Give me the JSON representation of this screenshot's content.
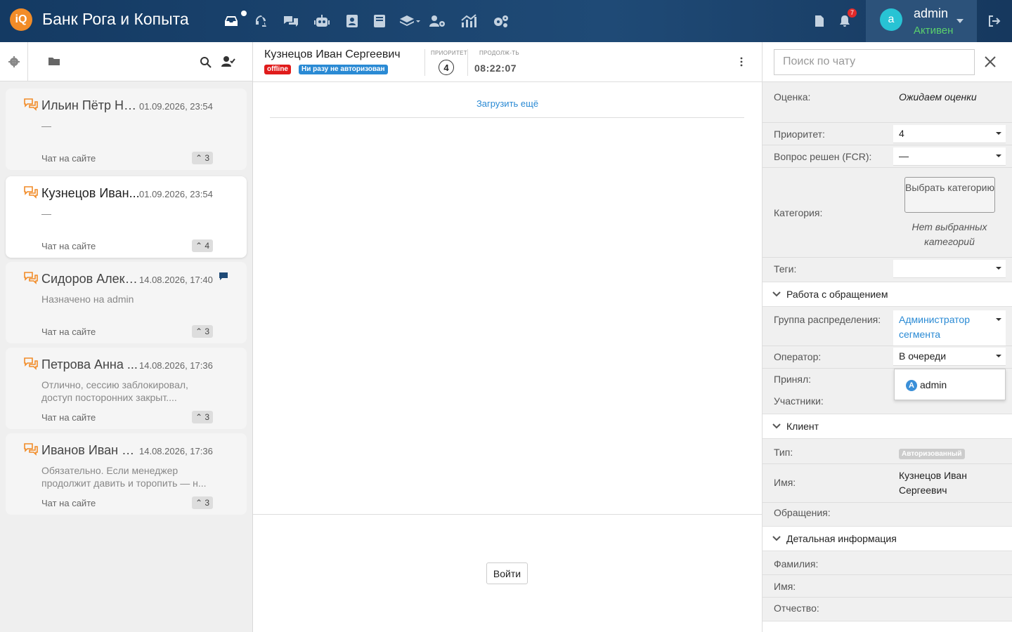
{
  "app": {
    "brand": "Банк Рога и Копыта",
    "logo_text": "iQ"
  },
  "topbar": {
    "notifications_count": "7",
    "user": {
      "initial": "a",
      "name": "admin",
      "status": "Активен"
    }
  },
  "chat_list": [
    {
      "name": "Ильин Пётр Ни...",
      "date": "01.09.2026, 23:54",
      "preview": "—",
      "source": "Чат на сайте",
      "priority": "3"
    },
    {
      "name": "Кузнецов Иван...",
      "date": "01.09.2026, 23:54",
      "preview": "—",
      "source": "Чат на сайте",
      "priority": "4"
    },
    {
      "name": "Сидоров Алекс...",
      "date": "14.08.2026, 17:40",
      "preview": "Назначено на admin",
      "source": "Чат на сайте",
      "priority": "3"
    },
    {
      "name": "Петрова Анна ...",
      "date": "14.08.2026, 17:36",
      "preview": "Отлично, сессию заблокировал, доступ посторонних закрыт....",
      "source": "Чат на сайте",
      "priority": "3"
    },
    {
      "name": "Иванов Иван И...",
      "date": "14.08.2026, 17:36",
      "preview": "Обязательно. Если менеджер продолжит давить и торопить — н...",
      "source": "Чат на сайте",
      "priority": "3"
    }
  ],
  "chat": {
    "name": "Кузнецов Иван Сергеевич",
    "tag_offline": "offline",
    "tag_auth": "Ни разу не авторизован",
    "priority_label": "ПРИОРИТЕТ",
    "priority": "4",
    "duration_label": "ПРОДОЛЖ-ТЬ",
    "duration": "08:22:07",
    "load_more": "Загрузить ещё",
    "login_button": "Войти"
  },
  "sidebar": {
    "search_placeholder": "Поиск по чату",
    "rating_label": "Оценка:",
    "rating_value": "Ожидаем оценки",
    "priority_label": "Приоритет:",
    "priority_value": "4",
    "fcr_label": "Вопрос решен (FCR):",
    "fcr_value": "—",
    "category_label": "Категория:",
    "category_button": "Выбрать категорию",
    "no_categories": "Нет выбранных категорий",
    "tags_label": "Теги:",
    "section_work": "Работа с обращением",
    "group_label": "Группа распределения:",
    "group_value": "Администратор сегмента",
    "operator_label": "Оператор:",
    "operator_value": "В очереди",
    "accepted_label": "Принял:",
    "participants_label": "Участники:",
    "operator_option": "admin",
    "operator_option_initial": "A",
    "section_client": "Клиент",
    "type_label": "Тип:",
    "type_value": "Авторизованный",
    "name_label": "Имя:",
    "name_value": "Кузнецов Иван Сергеевич",
    "appeals_label": "Обращения:",
    "section_details": "Детальная информация",
    "lastname_label": "Фамилия:",
    "firstname_label": "Имя:",
    "patronymic_label": "Отчество:"
  }
}
